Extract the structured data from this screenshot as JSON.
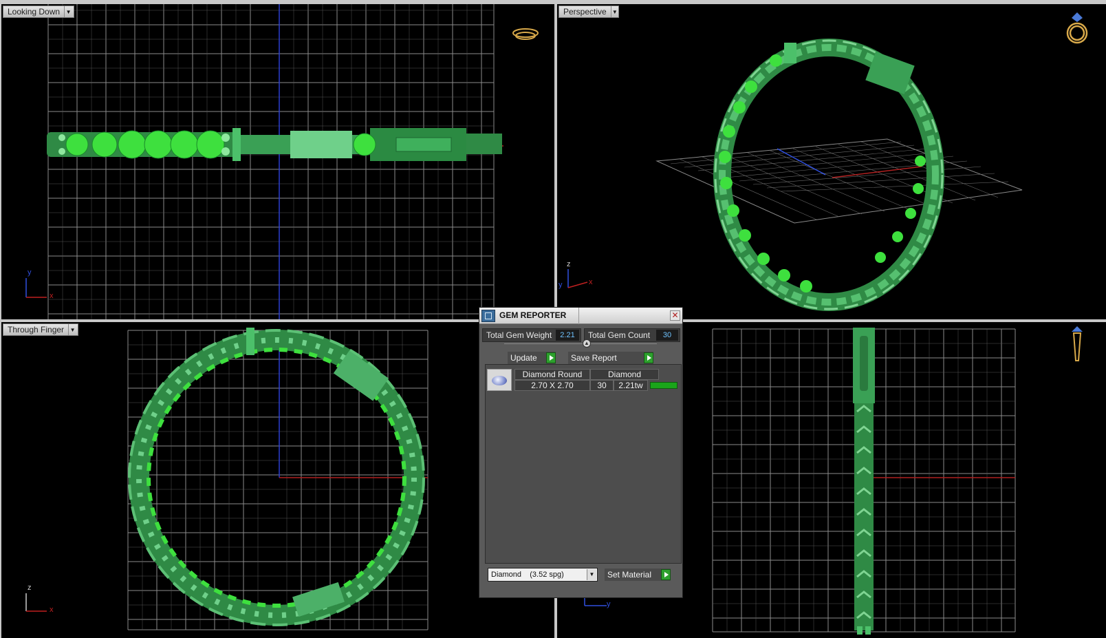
{
  "viewports": {
    "looking_down": {
      "label": "Looking Down",
      "axis_y": "y",
      "axis_x": "x"
    },
    "perspective": {
      "label": "Perspective",
      "axis_z": "z",
      "axis_y": "y",
      "axis_x": "x"
    },
    "through_finger": {
      "label": "Through Finger",
      "axis_z": "z",
      "axis_x": "x"
    },
    "side": {
      "axis_y": "y"
    }
  },
  "gem_reporter": {
    "title": "GEM REPORTER",
    "total_weight_label": "Total Gem Weight",
    "total_weight_value": "2.21",
    "total_count_label": "Total Gem Count",
    "total_count_value": "30",
    "update_label": "Update",
    "save_report_label": "Save Report",
    "rows": [
      {
        "shape": "Diamond Round",
        "material": "Diamond",
        "size": "2.70 X 2.70",
        "count": "30",
        "weight": "2.21tw"
      }
    ],
    "material_select": "Diamond    (3.52 spg)",
    "set_material_label": "Set Material"
  },
  "colors": {
    "model_green": "#3fa85a",
    "gem_green": "#3ee03e",
    "grid": "#9a9a9a",
    "viewport_bg": "#000000",
    "value_text": "#6fc3ff"
  }
}
